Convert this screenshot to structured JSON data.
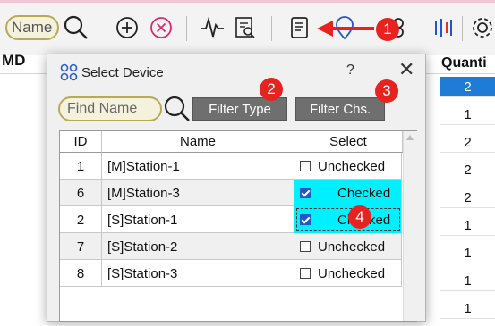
{
  "toolbar": {
    "name_chip": "Name",
    "icons": [
      "search-icon",
      "add-circle-icon",
      "remove-circle-icon",
      "pulse-icon",
      "report-search-icon",
      "document-icon",
      "map-pin-icon",
      "sliders-icon",
      "bars-icon",
      "gear-icon"
    ]
  },
  "grid": {
    "header_left": "MD",
    "header_right": "Quanti",
    "quantities": [
      "2",
      "1",
      "2",
      "2",
      "2",
      "1",
      "1",
      "1",
      "1"
    ],
    "selected_index": 0
  },
  "dialog": {
    "title": "Select Device",
    "help": "?",
    "close": "✕",
    "find_placeholder": "Find Name",
    "filter_type_label": "Filter Type",
    "filter_chs_label": "Filter Chs.",
    "columns": {
      "id": "ID",
      "name": "Name",
      "select": "Select"
    },
    "rows": [
      {
        "id": "1",
        "name": "[M]Station-1",
        "select": "Unchecked",
        "checked": false
      },
      {
        "id": "6",
        "name": "[M]Station-3",
        "select": "Checked",
        "checked": true
      },
      {
        "id": "2",
        "name": "[S]Station-1",
        "select": "Checked",
        "checked": true
      },
      {
        "id": "7",
        "name": "[S]Station-2",
        "select": "Unchecked",
        "checked": false
      },
      {
        "id": "8",
        "name": "[S]Station-3",
        "select": "Unchecked",
        "checked": false
      }
    ]
  },
  "callouts": [
    "1",
    "2",
    "3",
    "4"
  ],
  "colors": {
    "accent_red": "#e7231f",
    "checked_bg": "#00f0ff",
    "button_bg": "#6f6f6f",
    "chip_border": "#b7a95a",
    "selection_blue": "#1e7bd6"
  }
}
